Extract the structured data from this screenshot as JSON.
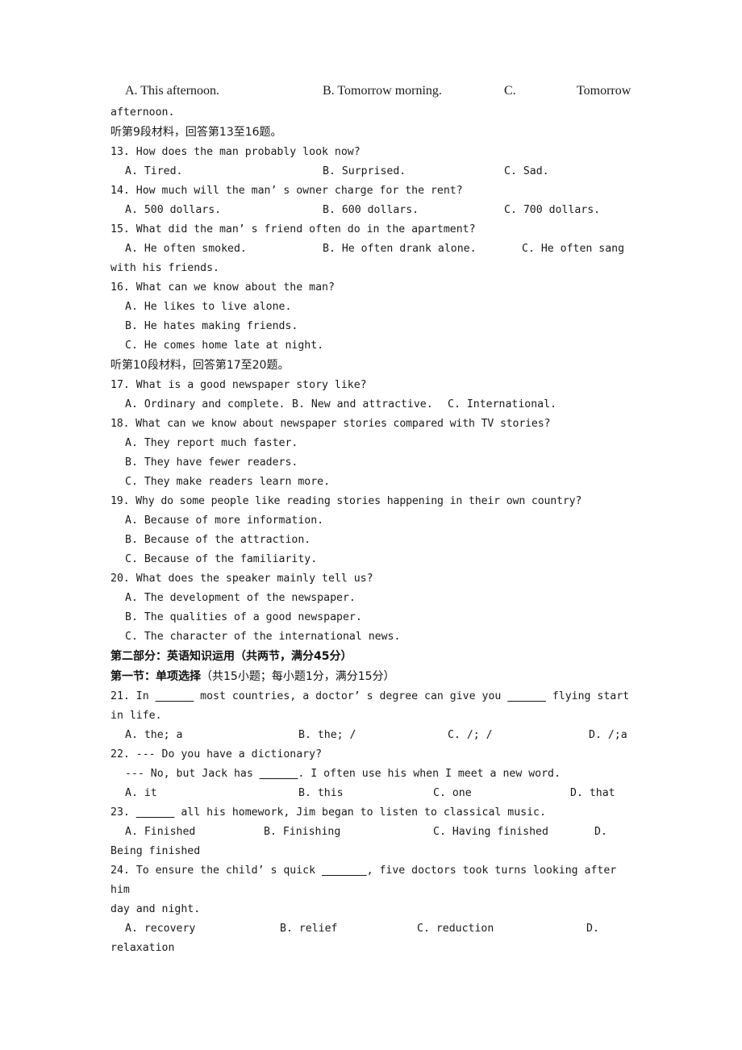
{
  "document": {
    "type": "exam-paper",
    "language": "en-zh",
    "page_background": "#ffffff",
    "text_color": "#1a1a1a"
  },
  "top_partial_question": {
    "options": {
      "a": "A. This afternoon.",
      "b": "B. Tomorrow morning.",
      "c_label": "C.",
      "c_text": "Tomorrow"
    },
    "runover": "afternoon."
  },
  "listening": {
    "direction_9": "听第9段材料，回答第13至16题。",
    "direction_10": "听第10段材料，回答第17至20题。",
    "questions": [
      {
        "number": "13.",
        "stem": "13. How does the man probably look now?",
        "layout": "three-column",
        "options": {
          "a": "A. Tired.",
          "b": "B. Surprised.",
          "c": "C. Sad."
        }
      },
      {
        "number": "14.",
        "stem": "14. How much will the man’ s owner charge for the rent?",
        "layout": "three-column",
        "options": {
          "a": "A. 500 dollars.",
          "b": "B. 600 dollars.",
          "c": "C. 700 dollars."
        }
      },
      {
        "number": "15.",
        "stem": "15. What did the man’ s friend often do in the apartment?",
        "layout": "three-column-runover",
        "options": {
          "a": "A. He often smoked.",
          "b": "B. He often drank alone.",
          "c": "C. He often sang"
        },
        "runover": "with his friends."
      },
      {
        "number": "16.",
        "stem": "16. What can we know about the man?",
        "layout": "stacked",
        "options": {
          "a": "A. He likes to live alone.",
          "b": "B. He hates making friends.",
          "c": "C. He comes home late at night."
        }
      },
      {
        "number": "17.",
        "stem": "17. What is a good newspaper story like?",
        "layout": "three-column-narrow",
        "options": {
          "a": "A. Ordinary and complete.",
          "b": "B. New and attractive.",
          "c": "C. International."
        }
      },
      {
        "number": "18.",
        "stem": "18. What can we know about newspaper stories compared with TV stories?",
        "layout": "stacked",
        "options": {
          "a": "A. They report much faster.",
          "b": "B. They have fewer readers.",
          "c": "C. They make readers learn more."
        }
      },
      {
        "number": "19.",
        "stem": "19. Why do some people like reading stories happening in their own country?",
        "layout": "stacked",
        "options": {
          "a": "A. Because of more information.",
          "b": "B. Because of the attraction.",
          "c": "C. Because of the familiarity."
        }
      },
      {
        "number": "20.",
        "stem": "20. What does the speaker mainly tell us?",
        "layout": "stacked",
        "options": {
          "a": "A. The development of the newspaper.",
          "b": "B. The qualities of a good newspaper.",
          "c": "C. The character of the international news."
        }
      }
    ]
  },
  "part_two": {
    "heading": "第二部分：英语知识运用（共两节，满分45分）",
    "section_one_heading_bold": "第一节：单项选择",
    "section_one_heading_paren": "（共15小题；每小题1分，满分15分）",
    "questions": [
      {
        "number": "21.",
        "stem_part1": "21. In ",
        "blank1": "______",
        "stem_part2": " most countries, a doctor’ s degree can give you ",
        "blank2": "______",
        "stem_part3": " flying start",
        "runover": "in life.",
        "options": {
          "a": "A. the; a",
          "b": "B. the; /",
          "c": "C. /; /",
          "d": "D. /;a"
        }
      },
      {
        "number": "22.",
        "stem": "22. --- Do you have a dictionary?",
        "stem_line2_part1": "--- No, but Jack has ",
        "stem_line2_blank": "______",
        "stem_line2_part2": ". I often use his when I meet a new word.",
        "options": {
          "a": "A. it",
          "b": "B. this",
          "c": "C. one",
          "d": "D. that"
        }
      },
      {
        "number": "23.",
        "stem_part1": "23. ",
        "blank1": "______",
        "stem_part2": " all his homework, Jim began to listen to classical music.",
        "options": {
          "a": "A. Finished",
          "b": "B. Finishing",
          "c": "C. Having finished",
          "d": "D."
        },
        "runover": "Being finished"
      },
      {
        "number": "24.",
        "stem_part1": "24. To ensure the child’ s quick ",
        "blank1": "_______",
        "stem_part2": ", five doctors took turns looking after him",
        "runover_stem": "day and night.",
        "options": {
          "a": "A. recovery",
          "b": "B.  relief",
          "c": "C. reduction",
          "d": "D."
        },
        "runover": "relaxation"
      }
    ]
  }
}
